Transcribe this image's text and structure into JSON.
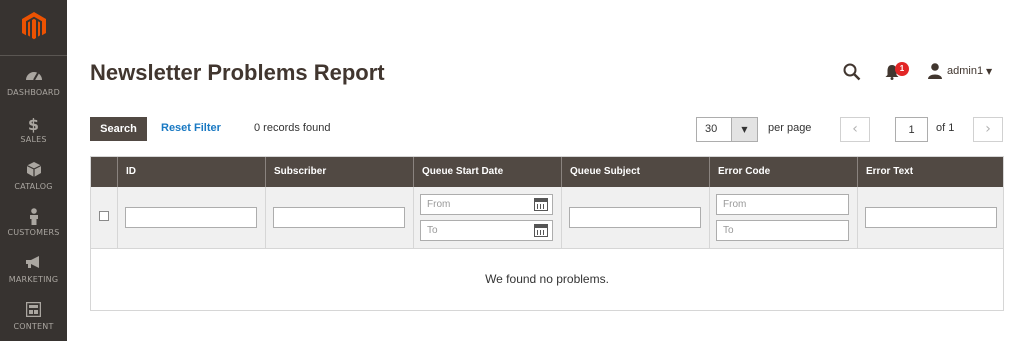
{
  "sidebar": {
    "items": [
      {
        "label": "DASHBOARD",
        "icon": "dashboard-icon"
      },
      {
        "label": "SALES",
        "icon": "dollar-icon"
      },
      {
        "label": "CATALOG",
        "icon": "box-icon"
      },
      {
        "label": "CUSTOMERS",
        "icon": "person-icon"
      },
      {
        "label": "MARKETING",
        "icon": "megaphone-icon"
      },
      {
        "label": "CONTENT",
        "icon": "layout-icon"
      }
    ]
  },
  "header": {
    "title": "Newsletter Problems Report",
    "notifications_count": "1",
    "user_name": "admin1"
  },
  "toolbar": {
    "search_label": "Search",
    "reset_label": "Reset Filter",
    "records_text": "0 records found",
    "per_page_value": "30",
    "per_page_label": "per page",
    "page_value": "1",
    "page_of": "of 1"
  },
  "grid": {
    "columns": [
      "ID",
      "Subscriber",
      "Queue Start Date",
      "Queue Subject",
      "Error Code",
      "Error Text"
    ],
    "filters": {
      "date_from_placeholder": "From",
      "date_to_placeholder": "To",
      "code_from_placeholder": "From",
      "code_to_placeholder": "To"
    },
    "empty_message": "We found no problems."
  },
  "colors": {
    "sidebar_bg": "#373330",
    "header_bg": "#514943",
    "accent_orange": "#eb5202",
    "link_blue": "#1979c3",
    "badge_red": "#e22626"
  }
}
